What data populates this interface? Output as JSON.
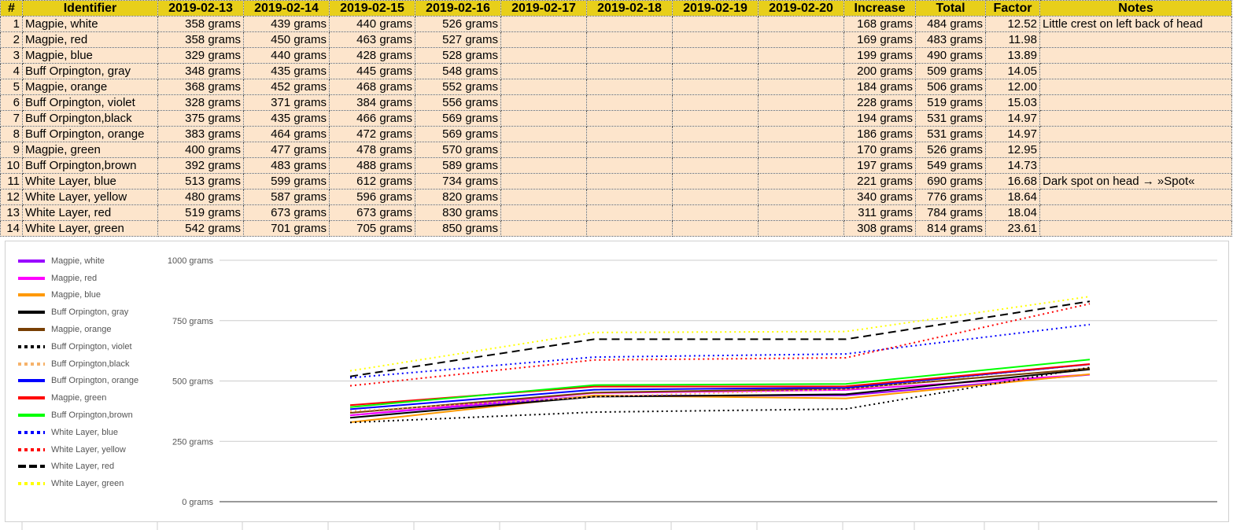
{
  "table": {
    "headers": [
      "#",
      "Identifier",
      "2019-02-13",
      "2019-02-14",
      "2019-02-15",
      "2019-02-16",
      "2019-02-17",
      "2019-02-18",
      "2019-02-19",
      "2019-02-20",
      "Increase",
      "Total",
      "Factor",
      "Notes"
    ],
    "rows": [
      {
        "n": "1",
        "id": "Magpie, white",
        "d13": "358 grams",
        "d14": "439 grams",
        "d15": "440 grams",
        "d16": "526 grams",
        "inc": "168 grams",
        "tot": "484 grams",
        "fac": "12.52",
        "note": "Little crest on left back of head"
      },
      {
        "n": "2",
        "id": "Magpie, red",
        "d13": "358 grams",
        "d14": "450 grams",
        "d15": "463 grams",
        "d16": "527 grams",
        "inc": "169 grams",
        "tot": "483 grams",
        "fac": "11.98",
        "note": ""
      },
      {
        "n": "3",
        "id": "Magpie, blue",
        "d13": "329 grams",
        "d14": "440 grams",
        "d15": "428 grams",
        "d16": "528 grams",
        "inc": "199 grams",
        "tot": "490 grams",
        "fac": "13.89",
        "note": ""
      },
      {
        "n": "4",
        "id": "Buff Orpington, gray",
        "d13": "348 grams",
        "d14": "435 grams",
        "d15": "445 grams",
        "d16": "548 grams",
        "inc": "200 grams",
        "tot": "509 grams",
        "fac": "14.05",
        "note": ""
      },
      {
        "n": "5",
        "id": "Magpie, orange",
        "d13": "368 grams",
        "d14": "452 grams",
        "d15": "468 grams",
        "d16": "552 grams",
        "inc": "184 grams",
        "tot": "506 grams",
        "fac": "12.00",
        "note": ""
      },
      {
        "n": "6",
        "id": "Buff Orpington, violet",
        "d13": "328 grams",
        "d14": "371 grams",
        "d15": "384 grams",
        "d16": "556 grams",
        "inc": "228 grams",
        "tot": "519 grams",
        "fac": "15.03",
        "note": ""
      },
      {
        "n": "7",
        "id": "Buff Orpington,black",
        "d13": "375 grams",
        "d14": "435 grams",
        "d15": "466 grams",
        "d16": "569 grams",
        "inc": "194 grams",
        "tot": "531 grams",
        "fac": "14.97",
        "note": ""
      },
      {
        "n": "8",
        "id": "Buff Orpington, orange",
        "d13": "383 grams",
        "d14": "464 grams",
        "d15": "472 grams",
        "d16": "569 grams",
        "inc": "186 grams",
        "tot": "531 grams",
        "fac": "14.97",
        "note": ""
      },
      {
        "n": "9",
        "id": "Magpie, green",
        "d13": "400 grams",
        "d14": "477 grams",
        "d15": "478 grams",
        "d16": "570 grams",
        "inc": "170 grams",
        "tot": "526 grams",
        "fac": "12.95",
        "note": ""
      },
      {
        "n": "10",
        "id": "Buff Orpington,brown",
        "d13": "392 grams",
        "d14": "483 grams",
        "d15": "488 grams",
        "d16": "589 grams",
        "inc": "197 grams",
        "tot": "549 grams",
        "fac": "14.73",
        "note": ""
      },
      {
        "n": "11",
        "id": "White Layer, blue",
        "d13": "513 grams",
        "d14": "599 grams",
        "d15": "612 grams",
        "d16": "734 grams",
        "inc": "221 grams",
        "tot": "690 grams",
        "fac": "16.68",
        "note": "Dark spot on head → »Spot«"
      },
      {
        "n": "12",
        "id": "White Layer, yellow",
        "d13": "480 grams",
        "d14": "587 grams",
        "d15": "596 grams",
        "d16": "820 grams",
        "inc": "340 grams",
        "tot": "776 grams",
        "fac": "18.64",
        "note": ""
      },
      {
        "n": "13",
        "id": "White Layer, red",
        "d13": "519 grams",
        "d14": "673 grams",
        "d15": "673 grams",
        "d16": "830 grams",
        "inc": "311 grams",
        "tot": "784 grams",
        "fac": "18.04",
        "note": ""
      },
      {
        "n": "14",
        "id": "White Layer, green",
        "d13": "542 grams",
        "d14": "701 grams",
        "d15": "705 grams",
        "d16": "850 grams",
        "inc": "308 grams",
        "tot": "814 grams",
        "fac": "23.61",
        "note": ""
      }
    ]
  },
  "colors": {
    "header_bg": "#e8cf1a",
    "row_bg": "#fde5cc",
    "grid_line": "#cccccc",
    "axis_line": "#333333"
  },
  "chart_data": {
    "type": "line",
    "x": [
      "2019-02-13",
      "2019-02-14",
      "2019-02-15",
      "2019-02-16"
    ],
    "ylim": [
      0,
      1000
    ],
    "yticks": [
      "0 grams",
      "250 grams",
      "500 grams",
      "750 grams",
      "1000 grams"
    ],
    "ytick_values": [
      0,
      250,
      500,
      750,
      1000
    ],
    "grid": true,
    "legend_position": "left",
    "series": [
      {
        "name": "Magpie, white",
        "values": [
          358,
          439,
          440,
          526
        ],
        "color": "#9900ff",
        "dash": "solid"
      },
      {
        "name": "Magpie, red",
        "values": [
          358,
          450,
          463,
          527
        ],
        "color": "#ff00ff",
        "dash": "solid"
      },
      {
        "name": "Magpie, blue",
        "values": [
          329,
          440,
          428,
          528
        ],
        "color": "#ff9900",
        "dash": "solid"
      },
      {
        "name": "Buff Orpington, gray",
        "values": [
          348,
          435,
          445,
          548
        ],
        "color": "#000000",
        "dash": "solid"
      },
      {
        "name": "Magpie, orange",
        "values": [
          368,
          452,
          468,
          552
        ],
        "color": "#783f04",
        "dash": "solid"
      },
      {
        "name": "Buff Orpington, violet",
        "values": [
          328,
          371,
          384,
          556
        ],
        "color": "#000000",
        "dash": "dotted"
      },
      {
        "name": "Buff Orpington,black",
        "values": [
          375,
          435,
          466,
          569
        ],
        "color": "#f6b26b",
        "dash": "dotted"
      },
      {
        "name": "Buff Orpington, orange",
        "values": [
          383,
          464,
          472,
          569
        ],
        "color": "#0000ff",
        "dash": "solid"
      },
      {
        "name": "Magpie, green",
        "values": [
          400,
          477,
          478,
          570
        ],
        "color": "#ff0000",
        "dash": "solid"
      },
      {
        "name": "Buff Orpington,brown",
        "values": [
          392,
          483,
          488,
          589
        ],
        "color": "#00ff00",
        "dash": "solid"
      },
      {
        "name": "White Layer, blue",
        "values": [
          513,
          599,
          612,
          734
        ],
        "color": "#0000ff",
        "dash": "dotted"
      },
      {
        "name": "White Layer, yellow",
        "values": [
          480,
          587,
          596,
          820
        ],
        "color": "#ff0000",
        "dash": "dotted"
      },
      {
        "name": "White Layer, red",
        "values": [
          519,
          673,
          673,
          830
        ],
        "color": "#000000",
        "dash": "dashed"
      },
      {
        "name": "White Layer, green",
        "values": [
          542,
          701,
          705,
          850
        ],
        "color": "#ffff00",
        "dash": "dotted"
      }
    ]
  }
}
